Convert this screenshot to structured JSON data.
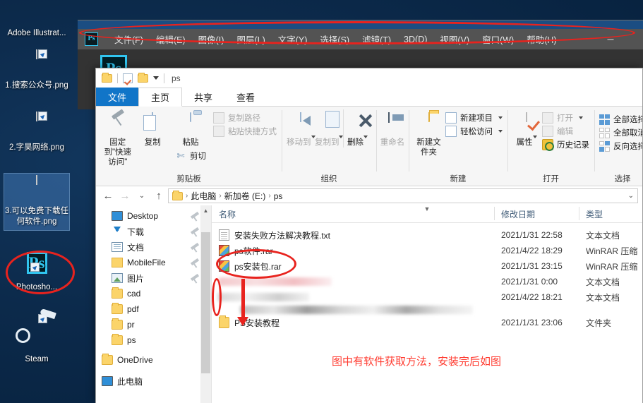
{
  "desktop": {
    "icons": [
      {
        "label": "Adobe Illustrat...",
        "type": "app-shortcut",
        "selected": false
      },
      {
        "label": "1.搜索公众号.png",
        "type": "png-thumb",
        "selected": false
      },
      {
        "label": "2.字昊网络.png",
        "type": "png-thumb",
        "selected": false
      },
      {
        "label": "3.可以免费下载任何软件.png",
        "type": "png-thumb",
        "selected": true
      },
      {
        "label": "Photosho...",
        "type": "photoshop-shortcut",
        "selected": false
      },
      {
        "label": "Steam",
        "type": "steam-shortcut",
        "selected": false
      }
    ]
  },
  "photoshop": {
    "logo": "Ps",
    "menus": [
      "文件(F)",
      "编辑(E)",
      "图像(I)",
      "图层(L)",
      "文字(Y)",
      "选择(S)",
      "滤镜(T)",
      "3D(D)",
      "视图(V)",
      "窗口(W)",
      "帮助(H)"
    ]
  },
  "explorer": {
    "quick_access": {
      "title": "ps",
      "items": [
        "folder-icon",
        "properties-check-icon",
        "new-folder-icon",
        "customize-caret-icon"
      ]
    },
    "tabs": [
      {
        "label": "文件",
        "state": "file"
      },
      {
        "label": "主页",
        "state": "active"
      },
      {
        "label": "共享",
        "state": "normal"
      },
      {
        "label": "查看",
        "state": "normal"
      }
    ],
    "ribbon_groups": [
      {
        "title": "剪贴板",
        "big_buttons": [
          {
            "label": "固定到\"快速访问\"",
            "icon": "pin-icon",
            "enabled": true
          },
          {
            "label": "复制",
            "icon": "copy-icon",
            "enabled": true
          },
          {
            "label": "粘贴",
            "icon": "paste-icon",
            "enabled": true
          }
        ],
        "small_buttons": [
          {
            "label": "复制路径",
            "icon": "copy-path-icon",
            "enabled": false
          },
          {
            "label": "粘贴快捷方式",
            "icon": "paste-shortcut-icon",
            "enabled": false
          },
          {
            "label": "剪切",
            "icon": "cut-icon",
            "enabled": true
          }
        ]
      },
      {
        "title": "组织",
        "big_buttons": [
          {
            "label": "移动到",
            "icon": "move-to-icon",
            "enabled": false,
            "caret": true
          },
          {
            "label": "复制到",
            "icon": "copy-to-icon",
            "enabled": false,
            "caret": true
          },
          {
            "label": "删除",
            "icon": "delete-icon",
            "enabled": true,
            "caret": true
          },
          {
            "label": "重命名",
            "icon": "rename-icon",
            "enabled": false
          }
        ],
        "small_buttons": []
      },
      {
        "title": "新建",
        "big_buttons": [
          {
            "label": "新建文件夹",
            "icon": "new-folder-icon",
            "enabled": true
          }
        ],
        "small_buttons": [
          {
            "label": "新建项目",
            "icon": "new-item-icon",
            "enabled": true,
            "caret": true
          },
          {
            "label": "轻松访问",
            "icon": "easy-access-icon",
            "enabled": true,
            "caret": true
          }
        ]
      },
      {
        "title": "打开",
        "big_buttons": [
          {
            "label": "属性",
            "icon": "properties-icon",
            "enabled": true,
            "caret": true
          }
        ],
        "small_buttons": [
          {
            "label": "打开",
            "icon": "open-icon",
            "enabled": false,
            "caret": true
          },
          {
            "label": "编辑",
            "icon": "edit-icon",
            "enabled": false
          },
          {
            "label": "历史记录",
            "icon": "history-icon",
            "enabled": true
          }
        ]
      },
      {
        "title": "选择",
        "big_buttons": [],
        "small_buttons": [
          {
            "label": "全部选择",
            "icon": "select-all-icon",
            "enabled": true
          },
          {
            "label": "全部取消",
            "icon": "select-none-icon",
            "enabled": true
          },
          {
            "label": "反向选择",
            "icon": "invert-selection-icon",
            "enabled": true
          }
        ]
      }
    ],
    "address_bar": {
      "back": "←",
      "forward": "→",
      "recent": "⌄",
      "up": "↑",
      "crumbs": [
        "此电脑",
        "新加卷 (E:)",
        "ps"
      ],
      "separator": "›",
      "dropdown_caret": "⌄"
    },
    "nav_pane": {
      "items": [
        {
          "label": "Desktop",
          "icon": "monitor-icon",
          "pinned": true,
          "level": 1
        },
        {
          "label": "下载",
          "icon": "download-icon",
          "pinned": true,
          "level": 1
        },
        {
          "label": "文档",
          "icon": "documents-icon",
          "pinned": true,
          "level": 1
        },
        {
          "label": "MobileFile",
          "icon": "folder-icon",
          "pinned": true,
          "level": 1
        },
        {
          "label": "图片",
          "icon": "pictures-icon",
          "pinned": true,
          "level": 1
        },
        {
          "label": "cad",
          "icon": "folder-icon",
          "pinned": false,
          "level": 1
        },
        {
          "label": "pdf",
          "icon": "folder-icon",
          "pinned": false,
          "level": 1
        },
        {
          "label": "pr",
          "icon": "folder-icon",
          "pinned": false,
          "level": 1
        },
        {
          "label": "ps",
          "icon": "folder-icon",
          "pinned": false,
          "level": 1
        },
        {
          "label": "OneDrive",
          "icon": "folder-icon",
          "pinned": false,
          "level": 0
        },
        {
          "label": "此电脑",
          "icon": "monitor-icon",
          "pinned": false,
          "level": 0
        }
      ]
    },
    "file_list": {
      "columns": [
        "名称",
        "修改日期",
        "类型"
      ],
      "rows": [
        {
          "name": "安装失败方法解决教程.txt",
          "date": "2021/1/31 22:58",
          "type": "文本文档",
          "icon": "txt-icon",
          "redacted": false
        },
        {
          "name": "ps软件.rar",
          "date": "2021/4/22 18:29",
          "type": "WinRAR 压缩",
          "icon": "rar-icon",
          "redacted": false
        },
        {
          "name": "ps安装包.rar",
          "date": "2021/1/31 23:15",
          "type": "WinRAR 压缩",
          "icon": "rar-icon",
          "redacted": false
        },
        {
          "name": "",
          "date": "2021/1/31 0:00",
          "type": "文本文档",
          "icon": "blurred",
          "redacted": true
        },
        {
          "name": "",
          "date": "2021/4/22 18:21",
          "type": "文本文档",
          "icon": "blurred",
          "redacted": true
        },
        {
          "name": "PS安装教程",
          "date": "2021/1/31 23:06",
          "type": "文件夹",
          "icon": "folder-icon",
          "redacted": false
        }
      ]
    },
    "annotation": "图中有软件获取方法，安装完后如图"
  },
  "colors": {
    "annotation_red": "#ff3b30",
    "marker_red": "#e8231e",
    "file_tab_blue": "#1175c8",
    "desktop_blue": "#0c2a4b"
  }
}
